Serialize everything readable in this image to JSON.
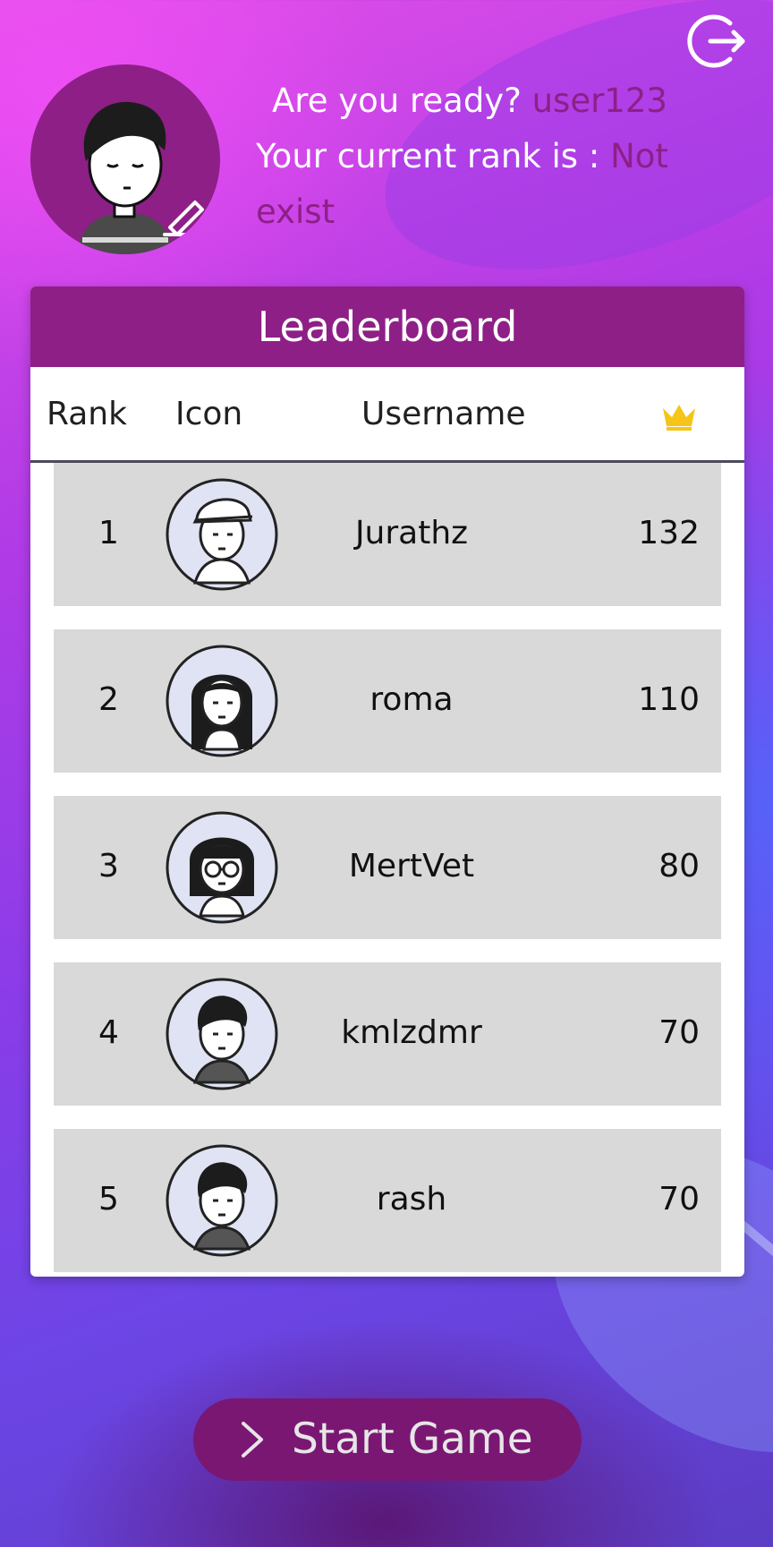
{
  "header": {
    "greeting_prefix": "Are you ready?",
    "username": "user123",
    "rank_prefix": "Your current rank is :",
    "rank_value_line1": "Not",
    "rank_value_line2": "exist",
    "exit_icon": "exit-icon",
    "avatar_icon": "user-avatar-edit-icon"
  },
  "leaderboard": {
    "title": "Leaderboard",
    "columns": {
      "rank": "Rank",
      "icon": "Icon",
      "username": "Username",
      "score_icon": "crown-icon"
    },
    "rows": [
      {
        "rank": "1",
        "username": "Jurathz",
        "score": "132",
        "icon": "avatar-cap-icon"
      },
      {
        "rank": "2",
        "username": "roma",
        "score": "110",
        "icon": "avatar-long-hair-icon"
      },
      {
        "rank": "3",
        "username": "MertVet",
        "score": "80",
        "icon": "avatar-glasses-icon"
      },
      {
        "rank": "4",
        "username": "kmlzdmr",
        "score": "70",
        "icon": "avatar-boy-icon"
      },
      {
        "rank": "5",
        "username": "rash",
        "score": "70",
        "icon": "avatar-boy-icon"
      }
    ]
  },
  "actions": {
    "start_label": "Start Game",
    "start_icon": "chevron-right-icon"
  },
  "colors": {
    "accent": "#8e1f86",
    "row_bg": "#d9d9d9",
    "crown": "#f5c518",
    "button": "#7a1773"
  }
}
